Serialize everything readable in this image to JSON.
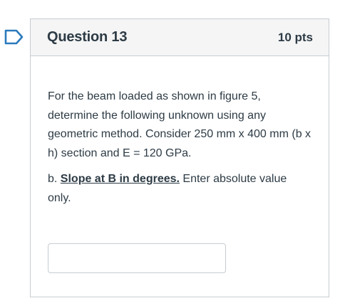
{
  "question": {
    "title": "Question 13",
    "points": "10 pts",
    "icon": "flag-outline-icon",
    "flag_color": "#2b7abc",
    "text": "For the beam loaded as shown in figure 5, determine the following unknown using any geometric method. Consider 250 mm x 400 mm (b x h) section and E = 120 GPa.",
    "part": {
      "prefix": "b. ",
      "emphasis": "Slope at B in degrees.",
      "suffix": " Enter absolute value only."
    },
    "answer": {
      "value": "",
      "placeholder": ""
    }
  }
}
